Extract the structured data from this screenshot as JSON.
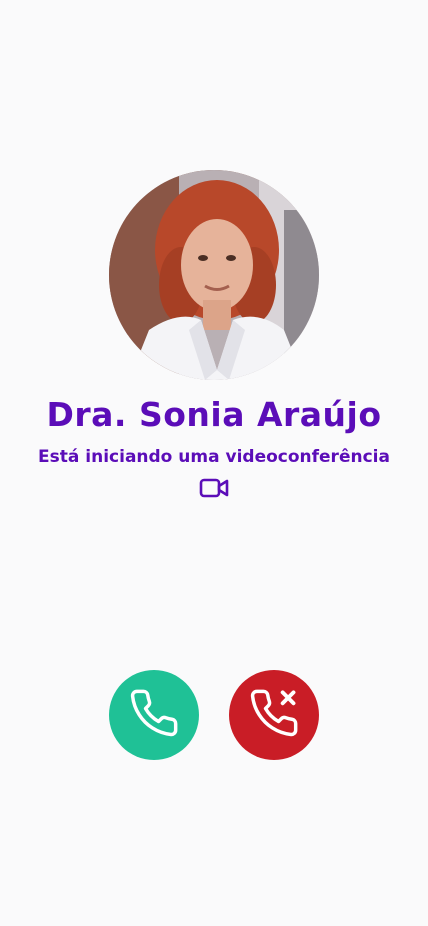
{
  "caller": {
    "name": "Dra. Sonia Araújo",
    "status": "Está iniciando uma videoconferência"
  },
  "icons": {
    "status_icon": "video-camera-icon",
    "accept_icon": "phone-icon",
    "decline_icon": "phone-x-icon"
  },
  "colors": {
    "primary": "#5b0db8",
    "accept": "#1fc196",
    "decline": "#c91d26",
    "background": "#fafafb"
  }
}
